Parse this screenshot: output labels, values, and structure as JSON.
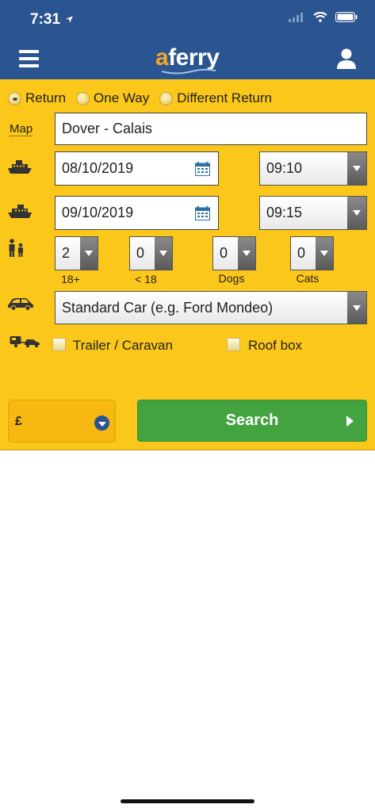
{
  "status_bar": {
    "time": "7:31"
  },
  "header": {
    "logo_a": "a",
    "logo_rest": "ferry"
  },
  "trip_type": {
    "options": [
      "Return",
      "One Way",
      "Different Return"
    ],
    "selected": "Return"
  },
  "route": {
    "map_label": "Map",
    "value": "Dover - Calais"
  },
  "outbound": {
    "date": "08/10/2019",
    "time": "09:10"
  },
  "return": {
    "date": "09/10/2019",
    "time": "09:15"
  },
  "passengers": [
    {
      "label": "18+",
      "value": "2"
    },
    {
      "label": "< 18",
      "value": "0"
    },
    {
      "label": "Dogs",
      "value": "0"
    },
    {
      "label": "Cats",
      "value": "0"
    }
  ],
  "vehicle": {
    "value": "Standard Car (e.g. Ford Mondeo)"
  },
  "extras": {
    "trailer_label": "Trailer / Caravan",
    "roof_box_label": "Roof box"
  },
  "currency": {
    "symbol": "£"
  },
  "search": {
    "label": "Search"
  },
  "colors": {
    "header": "#2a5590",
    "panel": "#fbc71a",
    "search": "#43a340",
    "logo_accent": "#f5a623"
  },
  "icons": [
    "location-arrow-icon",
    "signal-icon",
    "wifi-icon",
    "battery-icon",
    "menu-icon",
    "user-icon",
    "ferry-outbound-icon",
    "ferry-return-icon",
    "passengers-icon",
    "car-icon",
    "trailer-icon",
    "calendar-icon",
    "chevron-down-icon",
    "play-arrow-icon"
  ]
}
